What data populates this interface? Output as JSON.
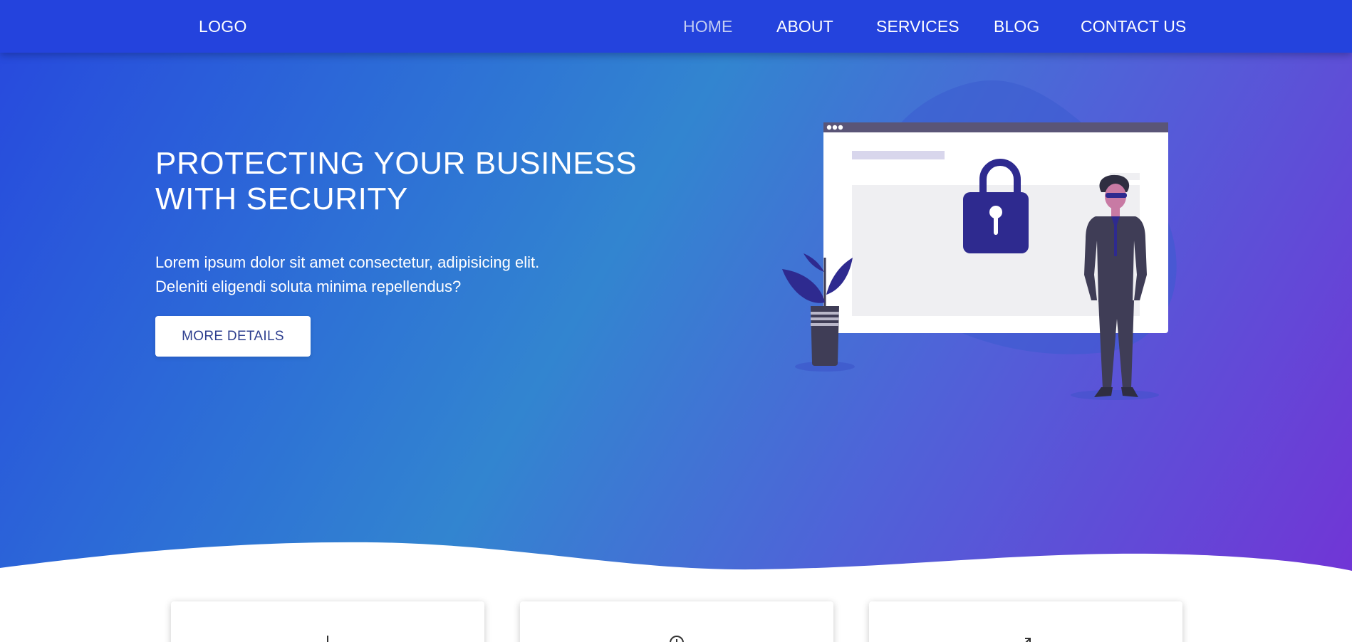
{
  "navbar": {
    "logo": "LOGO",
    "links": [
      {
        "label": "HOME",
        "active": true
      },
      {
        "label": "ABOUT",
        "active": false
      },
      {
        "label": "SERVICES",
        "active": false
      },
      {
        "label": "BLOG",
        "active": false
      },
      {
        "label": "CONTACT US",
        "active": false
      }
    ]
  },
  "hero": {
    "title_lines": [
      "PROTECTING YOUR BUSINESS",
      "WITH SECURITY"
    ],
    "text_lines": [
      "Lorem ipsum dolor sit amet consectetur, adipisicing elit.",
      "Deleniti eligendi soluta minima repellendus?"
    ],
    "cta_label": "MORE DETAILS"
  },
  "cards": [
    {
      "icon": "bar-icon"
    },
    {
      "icon": "clock-icon"
    },
    {
      "icon": "arrow-icon"
    }
  ],
  "colors": {
    "navbar": "#2443dd",
    "gradient_start": "#2748de",
    "gradient_mid": "#3285d0",
    "gradient_end": "#7135d6",
    "lock": "#2e2a8f",
    "button_text": "#2e3f8f"
  }
}
